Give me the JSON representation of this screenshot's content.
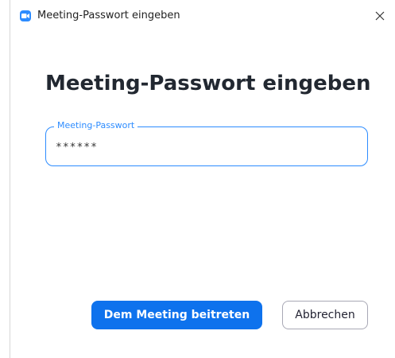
{
  "window": {
    "title": "Meeting-Passwort eingeben",
    "app_icon": "zoom-camera-icon",
    "close_icon": "close-icon"
  },
  "dialog": {
    "heading": "Meeting-Passwort eingeben",
    "password_field": {
      "label": "Meeting-Passwort",
      "value": "******"
    },
    "join_button": "Dem Meeting beitreten",
    "cancel_button": "Abbrechen"
  },
  "colors": {
    "accent": "#2d8cff",
    "primary_button": "#0e72ed",
    "heading_text": "#222831"
  }
}
